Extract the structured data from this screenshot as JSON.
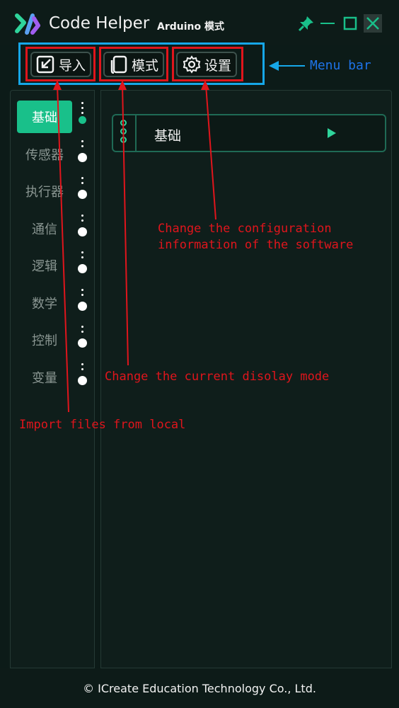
{
  "window": {
    "app_title": "Code Helper",
    "mode_label": "Arduino 模式",
    "pin_icon": "pin-icon",
    "minimize_icon": "minimize-icon",
    "maximize_icon": "maximize-icon",
    "close_icon": "close-icon"
  },
  "menubar": {
    "items": [
      {
        "label": "导入",
        "icon": "import-icon"
      },
      {
        "label": "模式",
        "icon": "mode-icon"
      },
      {
        "label": "设置",
        "icon": "settings-gear-icon"
      }
    ]
  },
  "sidebar": {
    "categories": [
      {
        "label": "基础",
        "active": true
      },
      {
        "label": "传感器",
        "active": false
      },
      {
        "label": "执行器",
        "active": false
      },
      {
        "label": "通信",
        "active": false
      },
      {
        "label": "逻辑",
        "active": false
      },
      {
        "label": "数学",
        "active": false
      },
      {
        "label": "控制",
        "active": false
      },
      {
        "label": "变量",
        "active": false
      }
    ]
  },
  "content": {
    "block_label": "基础"
  },
  "annotations": {
    "menu_bar": "Menu bar",
    "settings": "Change the configuration\ninformation of the software",
    "mode": "Change the current disolay mode",
    "import": "Import files from local"
  },
  "footer": {
    "copyright": "© ICreate Education Technology Co., Ltd."
  },
  "colors": {
    "background": "#0c1b18",
    "accent": "#19c08a",
    "annotation_red": "#e0151c",
    "annotation_blue": "#16a7e8",
    "annotation_text_blue": "#1e73e8"
  }
}
